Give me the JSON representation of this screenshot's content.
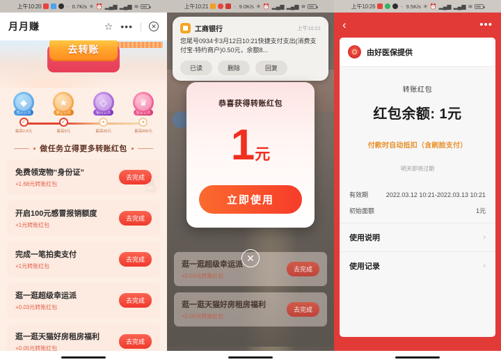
{
  "panel1": {
    "statusbar": {
      "time": "上午10:20",
      "speed": "0.7K/s",
      "dots": "··"
    },
    "header": {
      "title": "月月赚",
      "star_icon": "star-icon",
      "more_icon": "more-icon",
      "close_icon": "close-icon"
    },
    "banner": {
      "button_label": "去转账"
    },
    "badges": [
      {
        "label": "普通会员",
        "glyph": "◆",
        "coin_class": "bc-blue",
        "pill_class": "bp-blue"
      },
      {
        "label": "黄金会员",
        "glyph": "★",
        "coin_class": "bc-org",
        "pill_class": "bp-org"
      },
      {
        "label": "钻石会员",
        "glyph": "◇",
        "coin_class": "bc-pur",
        "pill_class": "bp-pur"
      },
      {
        "label": "至尊会员",
        "glyph": "♛",
        "coin_class": "bc-pink",
        "pill_class": "bp-pink"
      }
    ],
    "rail": [
      {
        "label": "最高0.8元",
        "state": "on",
        "mark": "✓"
      },
      {
        "label": "最高8元",
        "state": "on",
        "mark": "✓"
      },
      {
        "label": "最高88元",
        "state": "off",
        "mark": "●"
      },
      {
        "label": "最高888元",
        "state": "off",
        "mark": "●"
      }
    ],
    "tasks_title": "做任务立得更多转账红包",
    "tasks": [
      {
        "name": "免费领宠物“身份证”",
        "reward": "+1.68元转账红包",
        "button": "去完成",
        "has_cursor": true
      },
      {
        "name": "开启100元感冒报销额度",
        "reward": "+1元转账红包",
        "button": "去完成",
        "has_cursor": false
      },
      {
        "name": "完成一笔拍卖支付",
        "reward": "+1元转账红包",
        "button": "去完成",
        "has_cursor": false
      },
      {
        "name": "逛一逛超级幸运派",
        "reward": "+0.03元转账红包",
        "button": "去完成",
        "has_cursor": false
      },
      {
        "name": "逛一逛天猫好房租房福利",
        "reward": "+0.05元转账红包",
        "button": "去完成",
        "has_cursor": false
      }
    ]
  },
  "panel2": {
    "statusbar": {
      "time": "上午10:21",
      "speed": "9.0K/s",
      "dots": "··"
    },
    "notification": {
      "app": "工商银行",
      "time": "上午10:21",
      "body": "您尾号0934卡3月12日10:21快捷支付支出(消费支付宝-特约商户)0.50元，余额8...",
      "actions": [
        "已读",
        "删除",
        "回复"
      ]
    },
    "modal": {
      "title": "恭喜获得转账红包",
      "amount": "1",
      "unit": "元",
      "cta": "立即使用",
      "close_icon": "close-icon"
    },
    "background_tasks": [
      {
        "name": "逛一逛超级幸运派",
        "reward": "+0.03元转账红包",
        "button": "去完成"
      },
      {
        "name": "逛一逛天猫好房租房福利",
        "reward": "+0.05元转账红包",
        "button": "去完成"
      }
    ]
  },
  "panel3": {
    "statusbar": {
      "time": "上午10:26",
      "speed": "9.5K/s",
      "dots": "··"
    },
    "nav": {
      "back_icon": "back-arrow-icon",
      "more_icon": "more-icon"
    },
    "provider": {
      "name": "由好医保提供",
      "icon": "insurance-icon"
    },
    "detail": {
      "kicker": "转账红包",
      "balance": "红包余额: 1元",
      "note": "付款时自动抵扣（含刷脸支付）",
      "expire": "明天即将过期"
    },
    "info_rows": [
      {
        "key": "有效期",
        "value": "2022.03.12 10:21-2022.03.13 10:21"
      },
      {
        "key": "初始面额",
        "value": "1元"
      }
    ],
    "links": [
      {
        "label": "使用说明",
        "chevron": "›"
      },
      {
        "label": "使用记录",
        "chevron": "›"
      }
    ]
  },
  "colors": {
    "brand_red": "#e23a36",
    "accent_orange": "#f63c2a",
    "gold": "#e8902a"
  }
}
